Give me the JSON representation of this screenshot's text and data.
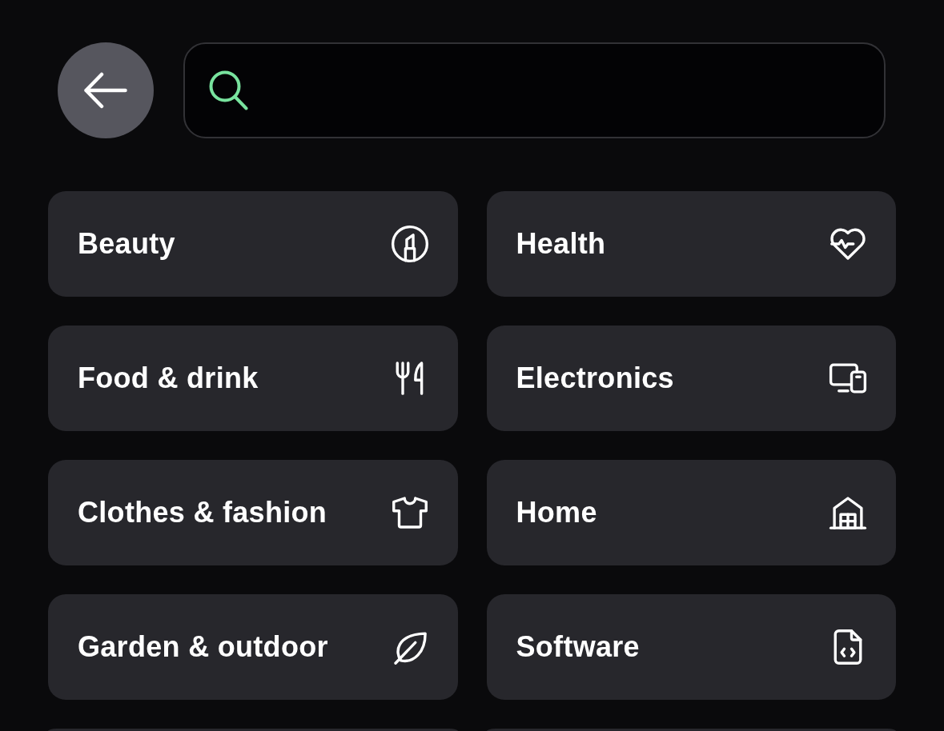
{
  "categories": [
    {
      "kind": "category",
      "label": "Beauty"
    },
    {
      "kind": "category",
      "label": "Health"
    },
    {
      "kind": "category",
      "label": "Food & drink"
    },
    {
      "kind": "category",
      "label": "Electronics"
    },
    {
      "kind": "category",
      "label": "Clothes & fashion"
    },
    {
      "kind": "category",
      "label": "Home"
    },
    {
      "kind": "category",
      "label": "Garden & outdoor"
    },
    {
      "kind": "category",
      "label": "Software"
    },
    {
      "kind": "cut_off"
    },
    {
      "kind": "cut_off"
    }
  ]
}
